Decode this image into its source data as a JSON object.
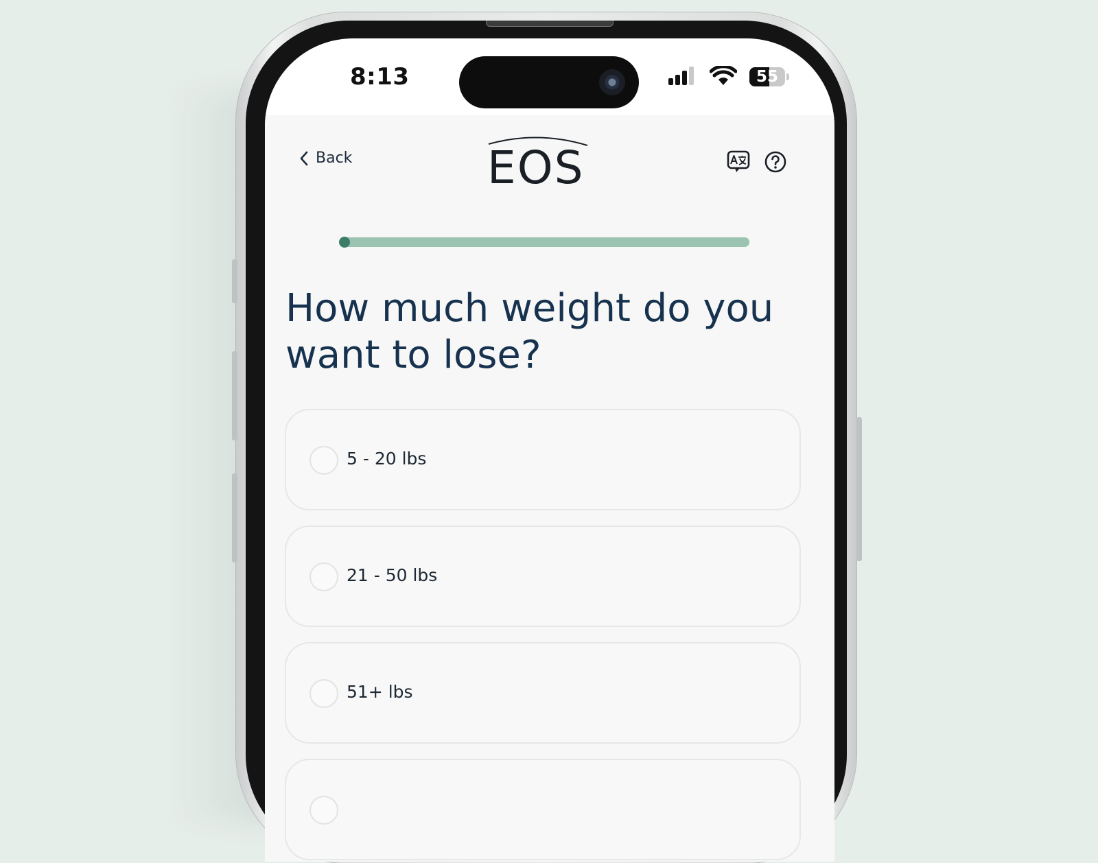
{
  "status_bar": {
    "time": "8:13",
    "battery": "55",
    "battery_fraction": 0.55,
    "icons": [
      "cellular-signal-icon",
      "wifi-icon",
      "battery-icon"
    ]
  },
  "header": {
    "back_label": "Back",
    "logo_text": "EOS",
    "icons": [
      "translate-icon",
      "help-icon"
    ]
  },
  "progress": {
    "value": 0.0
  },
  "question": "How much weight do you want to lose?",
  "options": [
    {
      "label": "5 - 20 lbs"
    },
    {
      "label": "21 - 50 lbs"
    },
    {
      "label": "51+ lbs"
    },
    {
      "label": ""
    }
  ],
  "colors": {
    "background": "#e6eeea",
    "accent": "#3d7d67",
    "progress_track": "#9ac3b2",
    "heading": "#16324f"
  }
}
